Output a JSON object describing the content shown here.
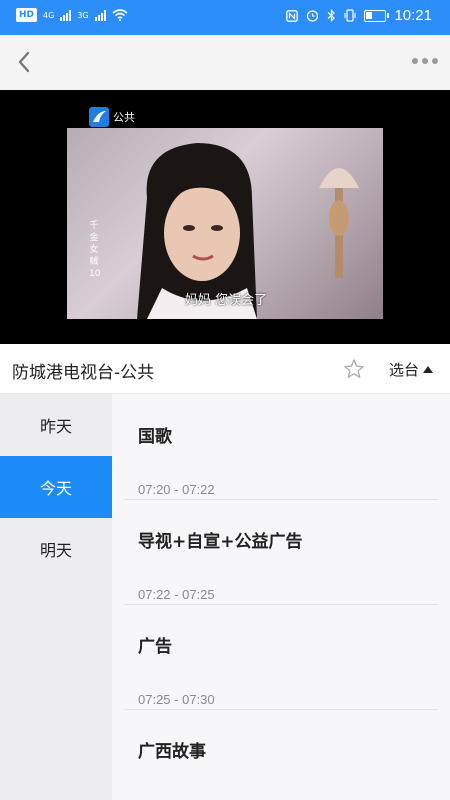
{
  "status_bar": {
    "left_badges": [
      "HD",
      "4G",
      "3G"
    ],
    "time": "10:21",
    "battery_level": 0.4,
    "icons": [
      "nfc-icon",
      "alarm-icon",
      "bluetooth-icon",
      "vibrate-icon",
      "battery-icon"
    ]
  },
  "top_bar": {
    "back_icon": "chevron-left-icon",
    "more_icon": "more-dots-icon"
  },
  "player": {
    "channel_logo_text": "公共",
    "drama_vertical_title": "千金女贼",
    "episode": "10",
    "subtitle": "妈妈 您误会了"
  },
  "channel_bar": {
    "channel_name": "防城港电视台-公共",
    "favorite_icon": "star-outline-icon",
    "select_label": "选台",
    "select_icon": "triangle-up-icon"
  },
  "days": [
    {
      "label": "昨天",
      "active": false
    },
    {
      "label": "今天",
      "active": true
    },
    {
      "label": "明天",
      "active": false
    }
  ],
  "programs": [
    {
      "title": "国歌",
      "time": "07:20 - 07:22"
    },
    {
      "title": "导视+自宣+公益广告",
      "time": "07:22 - 07:25"
    },
    {
      "title": "广告",
      "time": "07:25 - 07:30"
    },
    {
      "title": "广西故事",
      "time": ""
    }
  ],
  "colors": {
    "accent": "#1d8cf8",
    "status_bar": "#2c8ef8"
  }
}
